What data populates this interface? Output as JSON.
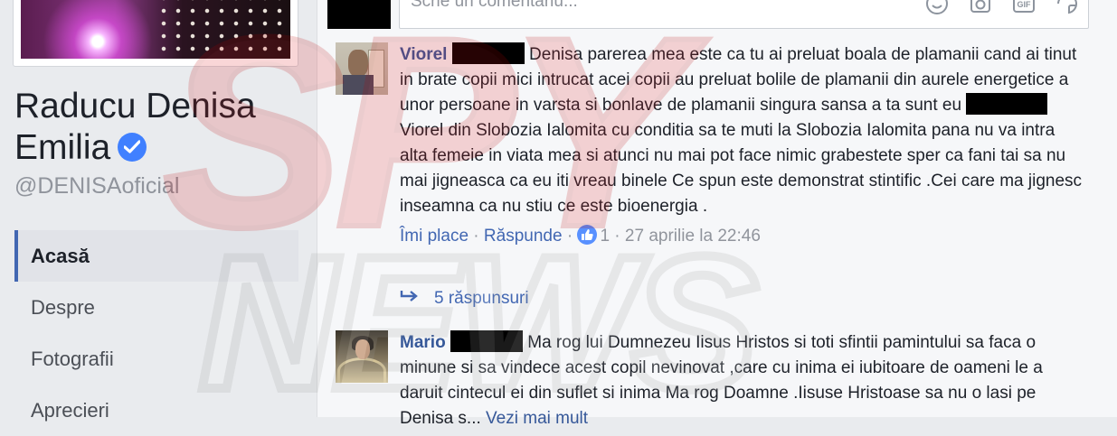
{
  "page": {
    "name": "Raducu Denisa Emilia",
    "handle": "@DENISAoficial"
  },
  "nav": [
    {
      "label": "Acasă",
      "active": true
    },
    {
      "label": "Despre",
      "active": false
    },
    {
      "label": "Fotografii",
      "active": false
    },
    {
      "label": "Aprecieri",
      "active": false
    }
  ],
  "composer": {
    "placeholder": "Scrie un comentariu..."
  },
  "comments": [
    {
      "author": "Viorel",
      "text_1": "Denisa parerea mea este ca tu ai preluat boala de plamanii cand ai tinut in brate copii mici intrucat acei copii au preluat bolile de plamanii din aurele energetice a unor persoane in varsta si bonlave de plamanii singura sansa a ta sunt eu",
      "text_2": "Viorel din Slobozia Ialomita cu conditia sa te muti la Slobozia Ialomita pana nu va intra alta femeie in viata mea si atunci nu mai pot face nimic grabestete sper ca fani tai sa nu mai jigneasca ca eu iti vreau binele Ce spun este demonstrat stintific .Cei care ma jignesc inseamna ca nu stiu ce este bioenergia .",
      "like_label": "Îmi place",
      "reply_label": "Răspunde",
      "reaction_count": "1",
      "timestamp": "27 aprilie la 22:46",
      "replies_label": "5 răspunsuri"
    },
    {
      "author": "Mario",
      "text_1": "Ma rog lui Dumnezeu Iisus Hristos si toti sfintii pamintului sa faca o minune si sa vindece acest copil nevinovat ,care cu inima ei iubitoare de oameni le a daruit cintecul ei din suflet si inima Ma rog Doamne .Iisuse Hristoase sa nu o lasi pe Denisa s...",
      "see_more": "Vezi mai mult"
    }
  ],
  "watermark": {
    "text_top": "SPY",
    "text_bottom": "NEWS"
  },
  "colors": {
    "link": "#365899",
    "accent": "#4267b2",
    "watermark": "#e0161b"
  },
  "icons": [
    "verified-icon",
    "emoji-icon",
    "camera-icon",
    "gif-icon",
    "sticker-icon",
    "like-icon",
    "reply-arrow-icon"
  ]
}
